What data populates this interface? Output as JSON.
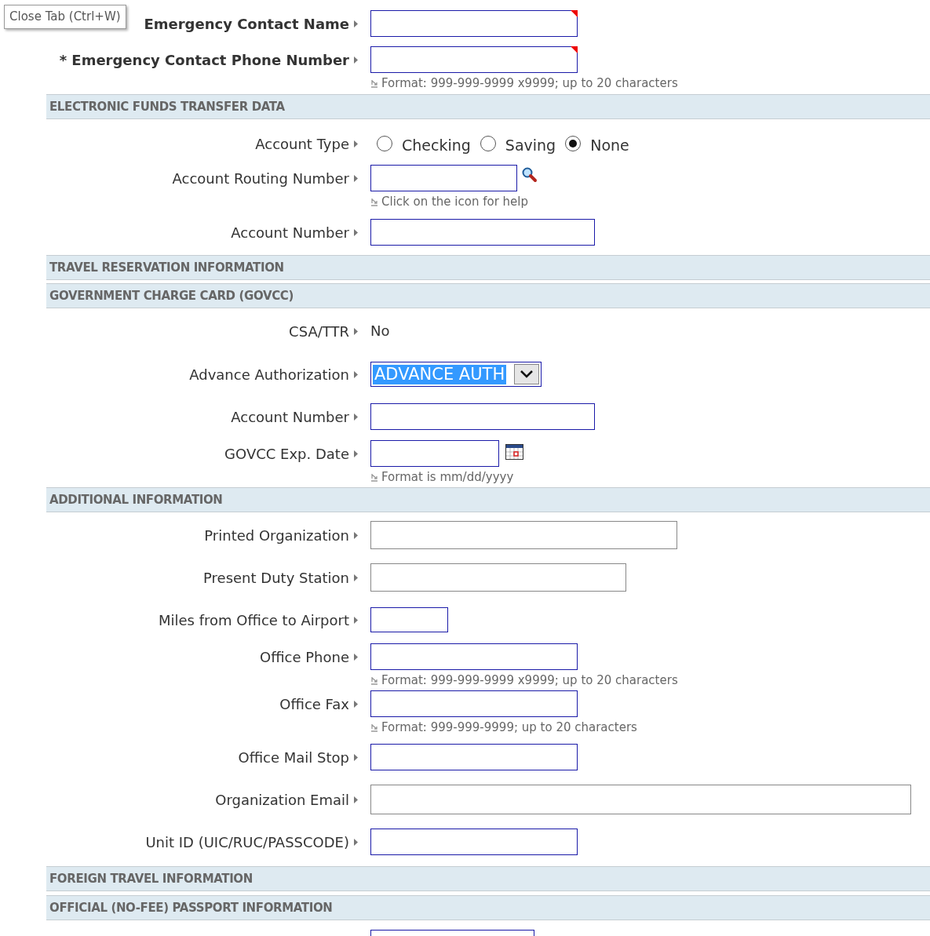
{
  "tooltip": "Close Tab (Ctrl+W)",
  "items": [
    {
      "kind": "field",
      "label": "Emergency Contact Name",
      "bold": true,
      "required": true,
      "outlined": true
    },
    {
      "kind": "field",
      "label": "* Emergency Contact Phone Number",
      "bold": true,
      "required": true,
      "outlined": true,
      "hint": "Format: 999-999-9999 x9999; up to 20 characters"
    },
    {
      "kind": "section",
      "title": "ELECTRONIC FUNDS TRANSFER DATA"
    },
    {
      "kind": "radio",
      "label": "Account Type",
      "options": [
        {
          "label": "Checking",
          "selected": false
        },
        {
          "label": "Saving",
          "selected": false
        },
        {
          "label": "None",
          "selected": true
        }
      ]
    },
    {
      "kind": "lookup",
      "label": "Account Routing Number",
      "outlined": true,
      "hint": "Click on the icon for help"
    },
    {
      "kind": "field",
      "label": "Account Number",
      "outlined": true
    },
    {
      "kind": "section",
      "title": "TRAVEL RESERVATION INFORMATION"
    },
    {
      "kind": "section",
      "title": "GOVERNMENT CHARGE CARD (GOVCC)"
    },
    {
      "kind": "static",
      "label": "CSA/TTR",
      "value": "No"
    },
    {
      "kind": "select",
      "label": "Advance Authorization",
      "value": "ADVANCE AUTH",
      "focused": true
    },
    {
      "kind": "field",
      "label": "Account Number",
      "outlined": true
    },
    {
      "kind": "date",
      "label": "GOVCC Exp. Date",
      "outlined": true,
      "hint": "Format is mm/dd/yyyy"
    },
    {
      "kind": "section",
      "title": "ADDITIONAL INFORMATION"
    },
    {
      "kind": "field",
      "label": "Printed Organization",
      "outlined": false
    },
    {
      "kind": "field",
      "label": "Present Duty Station",
      "outlined": false
    },
    {
      "kind": "field",
      "label": "Miles from Office to Airport",
      "outlined": true
    },
    {
      "kind": "field",
      "label": "Office Phone",
      "outlined": true,
      "hint": "Format: 999-999-9999 x9999; up to 20 characters"
    },
    {
      "kind": "field",
      "label": "Office Fax",
      "outlined": true,
      "hint": "Format: 999-999-9999; up to 20 characters"
    },
    {
      "kind": "field",
      "label": "Office Mail Stop",
      "outlined": true
    },
    {
      "kind": "field",
      "label": "Organization Email",
      "outlined": false
    },
    {
      "kind": "field",
      "label": "Unit ID (UIC/RUC/PASSCODE)",
      "outlined": true
    },
    {
      "kind": "section",
      "title": "FOREIGN TRAVEL INFORMATION"
    },
    {
      "kind": "section",
      "title": "OFFICIAL (NO-FEE) PASSPORT INFORMATION"
    },
    {
      "kind": "field",
      "outlined": true
    }
  ]
}
